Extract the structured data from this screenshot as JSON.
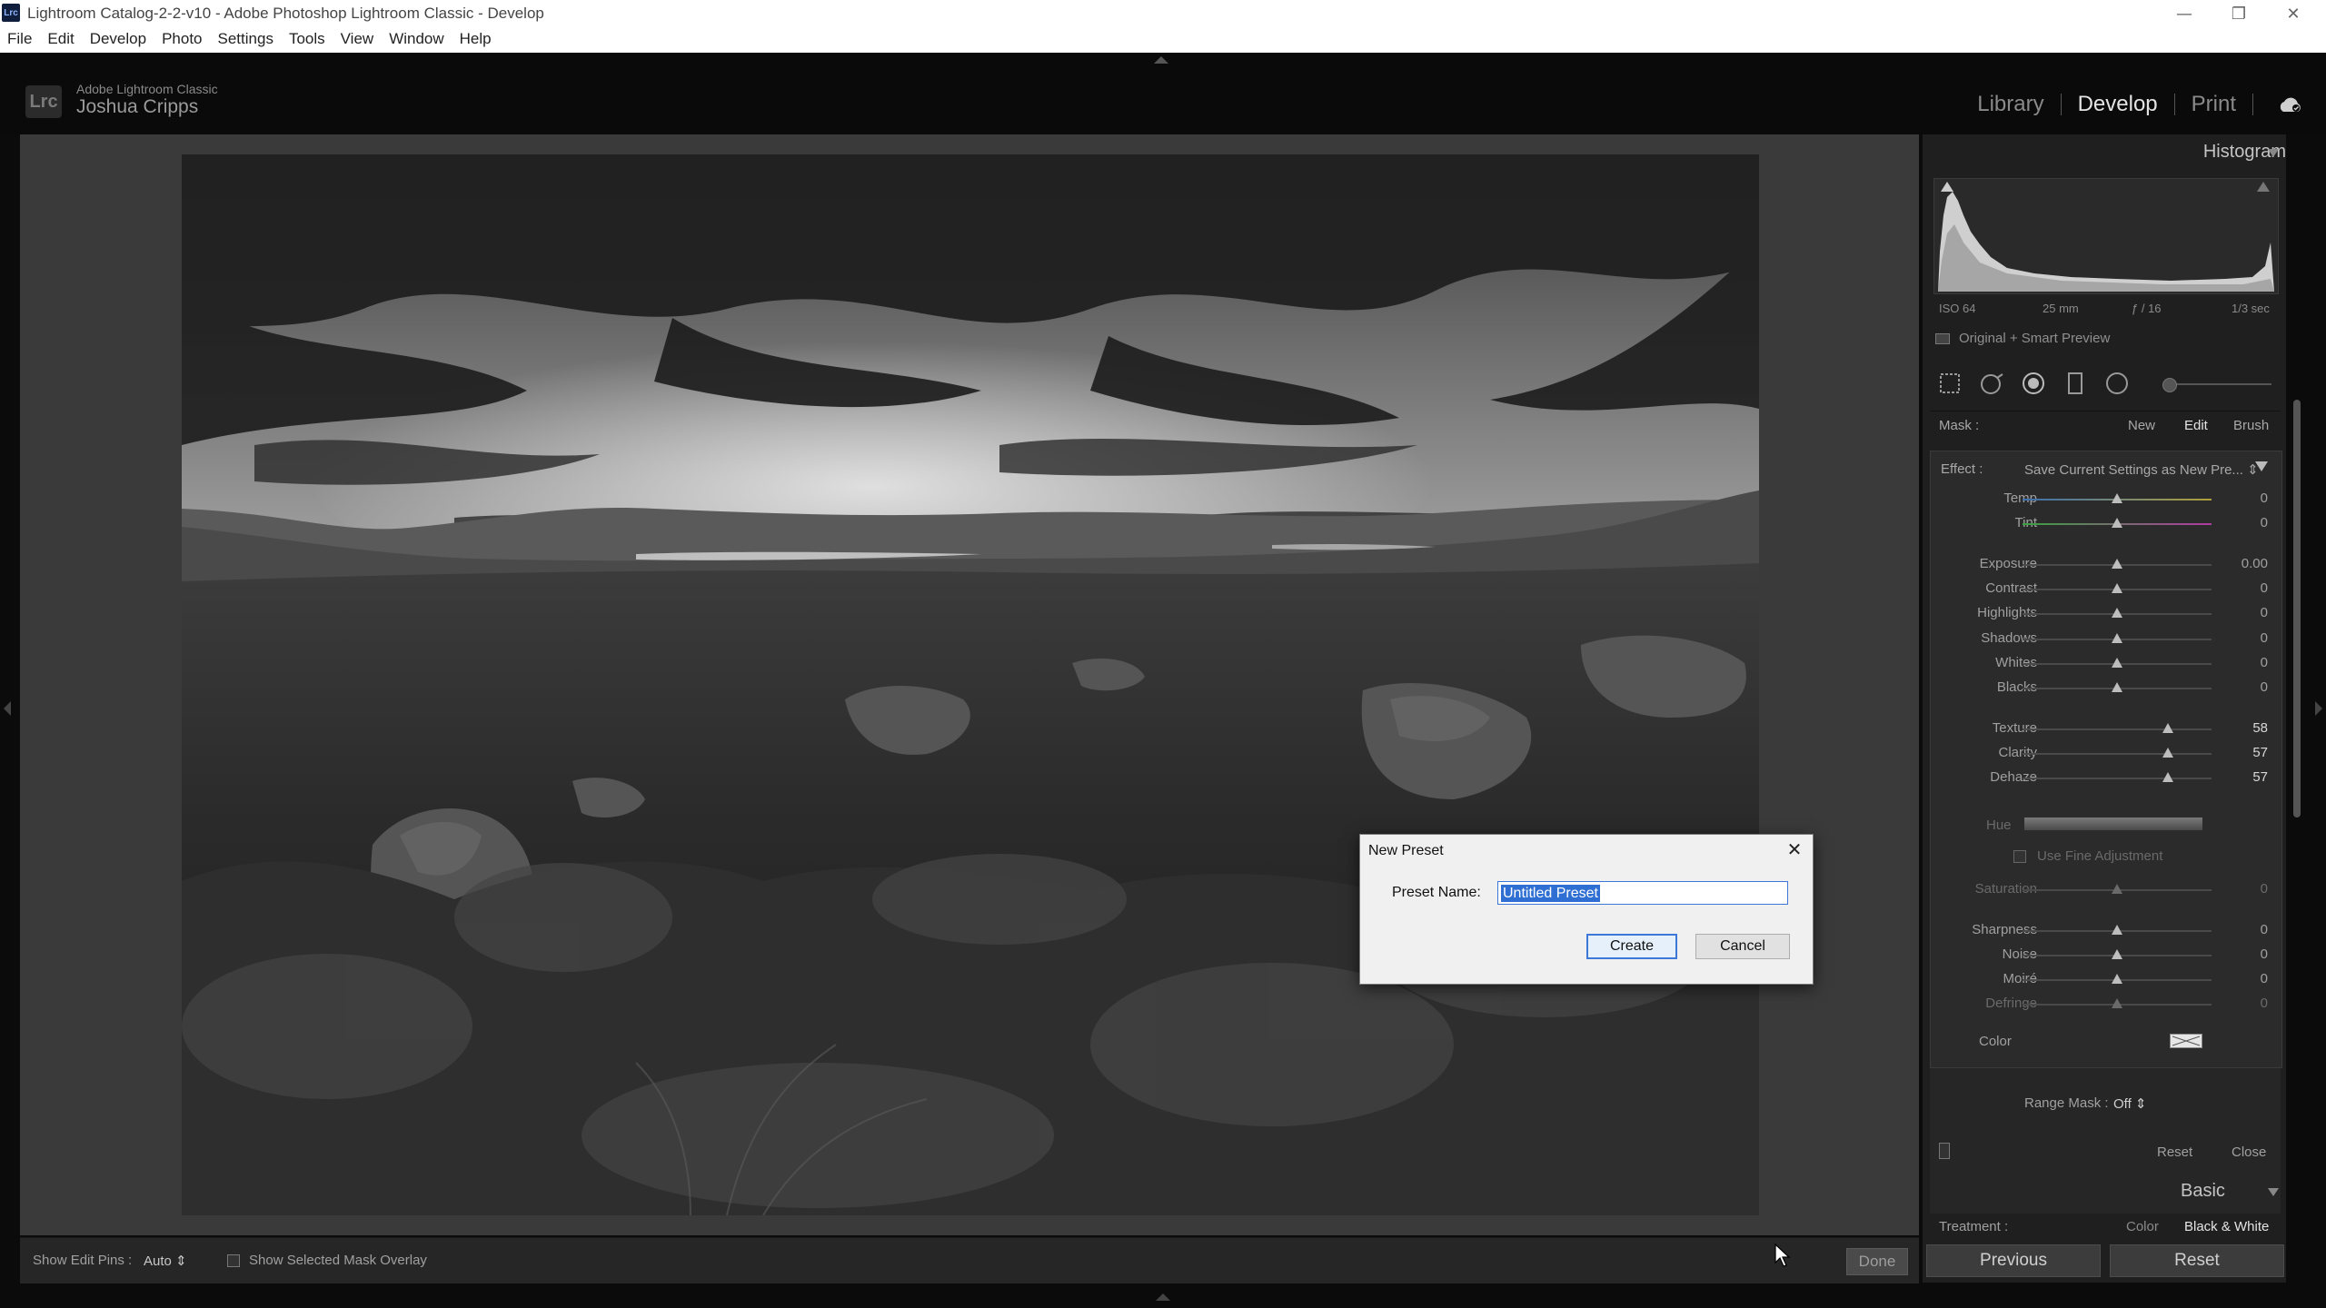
{
  "window": {
    "title": "Lightroom Catalog-2-2-v10 - Adobe Photoshop Lightroom Classic - Develop",
    "app_icon_text": "Lrc",
    "controls": {
      "minimize": "—",
      "maximize": "❐",
      "close": "✕"
    }
  },
  "menu": [
    "File",
    "Edit",
    "Develop",
    "Photo",
    "Settings",
    "Tools",
    "View",
    "Window",
    "Help"
  ],
  "header": {
    "logo": "Lrc",
    "brand": "Adobe Lightroom Classic",
    "user": "Joshua Cripps",
    "modules": [
      {
        "label": "Library",
        "active": false
      },
      {
        "label": "Develop",
        "active": true
      },
      {
        "label": "Print",
        "active": false
      }
    ],
    "cloud_icon": "cloud-sync-icon"
  },
  "histogram": {
    "title": "Histogram",
    "exif": {
      "iso": "ISO 64",
      "focal": "25 mm",
      "aperture": "ƒ / 16",
      "shutter": "1/3 sec"
    },
    "preview_label": "Original + Smart Preview"
  },
  "mask": {
    "label": "Mask :",
    "new": "New",
    "edit": "Edit",
    "brush": "Brush"
  },
  "effect": {
    "label": "Effect :",
    "value": "Save Current Settings as New Pre... ⇕",
    "sliders": [
      {
        "label": "Temp",
        "value": "0",
        "pos": 0.5
      },
      {
        "label": "Tint",
        "value": "0",
        "pos": 0.5
      },
      {
        "label": "Exposure",
        "value": "0.00",
        "pos": 0.5
      },
      {
        "label": "Contrast",
        "value": "0",
        "pos": 0.5
      },
      {
        "label": "Highlights",
        "value": "0",
        "pos": 0.5
      },
      {
        "label": "Shadows",
        "value": "0",
        "pos": 0.5
      },
      {
        "label": "Whites",
        "value": "0",
        "pos": 0.5
      },
      {
        "label": "Blacks",
        "value": "0",
        "pos": 0.5
      },
      {
        "label": "Texture",
        "value": "58",
        "pos": 0.77
      },
      {
        "label": "Clarity",
        "value": "57",
        "pos": 0.77
      },
      {
        "label": "Dehaze",
        "value": "57",
        "pos": 0.77
      },
      {
        "label": "Saturation",
        "value": "0",
        "pos": 0.5
      },
      {
        "label": "Sharpness",
        "value": "0",
        "pos": 0.5
      },
      {
        "label": "Noise",
        "value": "0",
        "pos": 0.5
      },
      {
        "label": "Moiré",
        "value": "0",
        "pos": 0.5
      },
      {
        "label": "Defringe",
        "value": "0",
        "pos": 0.5
      }
    ],
    "hue_label": "Hue",
    "fine_adjust_label": "Use Fine Adjustment",
    "color_label": "Color"
  },
  "range_mask": {
    "label": "Range Mask :",
    "value": "Off ⇕"
  },
  "mask_footer": {
    "reset": "Reset",
    "close": "Close"
  },
  "basic": {
    "title": "Basic",
    "treatment_label": "Treatment :",
    "color": "Color",
    "bw": "Black & White"
  },
  "buttons": {
    "previous": "Previous",
    "reset": "Reset"
  },
  "toolbar": {
    "pins_label": "Show Edit Pins :",
    "pins_value": "Auto ⇕",
    "overlay_label": "Show Selected Mask Overlay",
    "done": "Done"
  },
  "dialog": {
    "title": "New Preset",
    "close": "✕",
    "name_label": "Preset Name:",
    "name_value": "Untitled Preset",
    "create": "Create",
    "cancel": "Cancel"
  }
}
